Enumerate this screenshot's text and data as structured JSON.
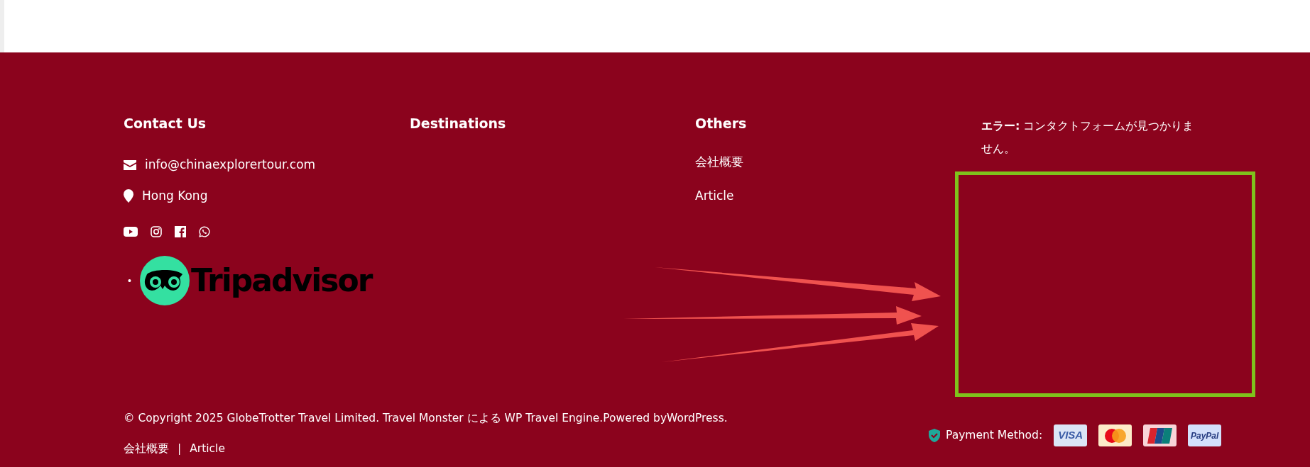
{
  "footer": {
    "contact": {
      "heading": "Contact Us",
      "email": "info@chinaexplorertour.com",
      "location": "Hong Kong",
      "social": [
        {
          "kind": "youtube"
        },
        {
          "kind": "instagram"
        },
        {
          "kind": "facebook"
        },
        {
          "kind": "whatsapp"
        }
      ],
      "badge": {
        "bullet": "•",
        "wordmark": "Tripadvisor"
      }
    },
    "destinations": {
      "heading": "Destinations"
    },
    "others": {
      "heading": "Others",
      "links": [
        "会社概要",
        "Article"
      ]
    },
    "form_notice": {
      "text": "**エラー:** コンタクトフォームが見つかりません。"
    },
    "copyright": "© Copyright 2025 GlobeTrotter Travel Limited. Travel Monster による WP Travel Engine.Powered byWordPress.",
    "bottom_links": [
      "会社概要",
      "Article"
    ],
    "separator": "|",
    "payment": {
      "label": "Payment Method:",
      "cards": [
        {
          "kind": "visa",
          "text": "VISA"
        },
        {
          "kind": "mastercard"
        },
        {
          "kind": "unionpay"
        },
        {
          "kind": "paypal",
          "text": "PayPal"
        }
      ]
    }
  }
}
